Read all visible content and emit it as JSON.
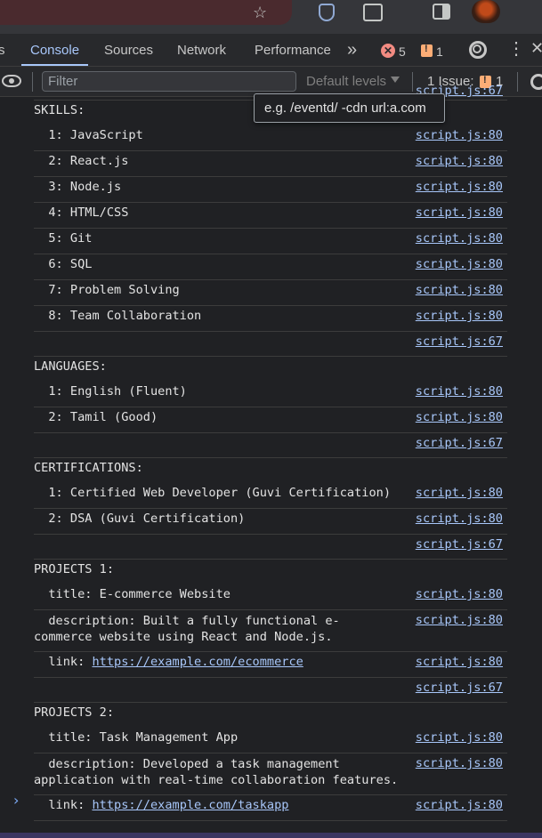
{
  "devtools": {
    "tabs": [
      {
        "label": "s"
      },
      {
        "label": "Console"
      },
      {
        "label": "Sources"
      },
      {
        "label": "Network"
      },
      {
        "label": "Performance"
      }
    ],
    "more_tabs": "»",
    "error_count": "5",
    "warning_count": "1",
    "error_glyph": "✕"
  },
  "toolbar": {
    "filter_placeholder": "Filter",
    "levels_label": "Default levels",
    "issues_label": "1 Issue:",
    "issues_count": "1"
  },
  "tooltip": {
    "text": "e.g. /eventd/ -cdn url:a.com"
  },
  "console": {
    "top_cut_source": "script.js:67",
    "rows": [
      {
        "msg": "SKILLS:",
        "src": ""
      },
      {
        "msg": "  1: JavaScript",
        "src": "script.js:80"
      },
      {
        "msg": "  2: React.js",
        "src": "script.js:80"
      },
      {
        "msg": "  3: Node.js",
        "src": "script.js:80"
      },
      {
        "msg": "  4: HTML/CSS",
        "src": "script.js:80"
      },
      {
        "msg": "  5: Git",
        "src": "script.js:80"
      },
      {
        "msg": "  6: SQL",
        "src": "script.js:80"
      },
      {
        "msg": "  7: Problem Solving",
        "src": "script.js:80"
      },
      {
        "msg": "  8: Team Collaboration",
        "src": "script.js:80"
      },
      {
        "msg": "",
        "src": "script.js:67"
      },
      {
        "msg": "LANGUAGES:",
        "src": ""
      },
      {
        "msg": "  1: English (Fluent)",
        "src": "script.js:80"
      },
      {
        "msg": "  2: Tamil (Good)",
        "src": "script.js:80"
      },
      {
        "msg": "",
        "src": "script.js:67"
      },
      {
        "msg": "CERTIFICATIONS:",
        "src": ""
      },
      {
        "msg": "  1: Certified Web Developer (Guvi Certification)",
        "src": "script.js:80"
      },
      {
        "msg": "  2: DSA (Guvi Certification)",
        "src": "script.js:80"
      },
      {
        "msg": "",
        "src": "script.js:67"
      },
      {
        "msg": "PROJECTS 1:",
        "src": ""
      },
      {
        "msg": "  title: E-commerce Website",
        "src": "script.js:80"
      },
      {
        "msg": "  description: Built a fully functional e-\ncommerce website using React and Node.js.",
        "src": "script.js:80"
      },
      {
        "msg": "  link: ",
        "link": "https://example.com/ecommerce",
        "src": "script.js:80"
      },
      {
        "msg": "",
        "src": "script.js:67"
      },
      {
        "msg": "PROJECTS 2:",
        "src": ""
      },
      {
        "msg": "  title: Task Management App",
        "src": "script.js:80"
      },
      {
        "msg": "  description: Developed a task management\napplication with real-time collaboration features.",
        "src": "script.js:80"
      },
      {
        "msg": "  link: ",
        "link": "https://example.com/taskapp",
        "src": "script.js:80"
      }
    ]
  },
  "colors": {
    "panel_bg": "#202124",
    "link": "#a8c7fa",
    "accent": "#a8c7fa"
  }
}
